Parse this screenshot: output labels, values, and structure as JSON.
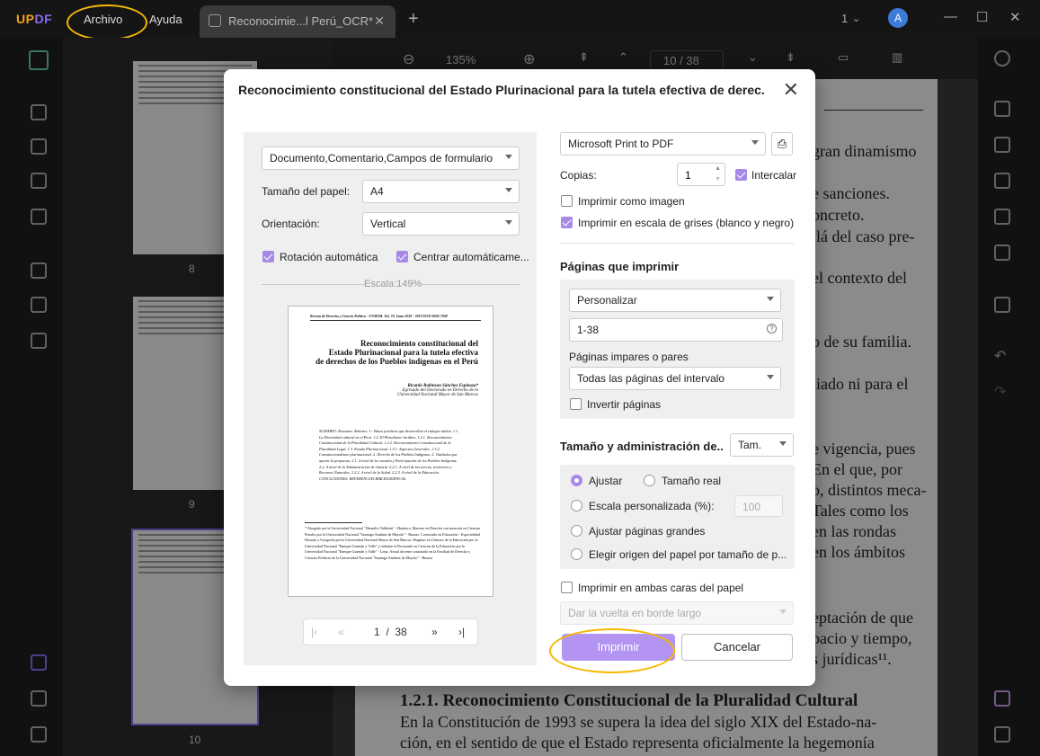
{
  "app": {
    "logo_u": "UP",
    "logo_df": "DF"
  },
  "menu": {
    "file": "Archivo",
    "help": "Ayuda"
  },
  "tab": {
    "title": "Reconocimie...l Perú_OCR*",
    "close": "✕",
    "new": "+"
  },
  "window": {
    "page_indicator": "1",
    "avatar": "A",
    "minimize": "—",
    "maximize": "☐",
    "close": "✕"
  },
  "toolbar": {
    "zoom": "135%",
    "current_page": "10",
    "separator": "/",
    "total_pages": "38"
  },
  "thumbnails": [
    {
      "label": "8"
    },
    {
      "label": "9"
    },
    {
      "label": "10"
    }
  ],
  "document": {
    "lines": [
      "gran dinamismo",
      "e sanciones.",
      "oncreto.",
      "llá del caso pre-",
      "el contexto del",
      "o de su familia.",
      "liado ni para el",
      "e vigencia, pues",
      "En el que, por",
      "o, distintos meca-",
      "Tales como los",
      "en las rondas",
      "en los ámbitos",
      "eptación de que",
      "pacio y tiempo,",
      "s jurídicas¹¹."
    ],
    "heading": "1.2.1. Reconocimiento Constitucional de la Pluralidad Cultural",
    "para1": "En la Constitución de 1993 se supera la idea del siglo XIX del Estado-na-",
    "para2": "ción, en el sentido de que el Estado representa oficialmente la hegemonía"
  },
  "dialog": {
    "title": "Reconocimiento constitucional del Estado Plurinacional para la tutela efectiva de derec.",
    "content_select": "Documento,Comentario,Campos de formulario",
    "paper_size_label": "Tamaño del papel:",
    "paper_size": "A4",
    "orientation_label": "Orientación:",
    "orientation": "Vertical",
    "auto_rotate": "Rotación automática",
    "auto_center": "Centrar automáticame...",
    "scale_label": "Escala:149%",
    "preview": {
      "header": "Revista de Derecho y Ciencia Política - UNMSM. Vol. 74. Lima 2018 - 2019 ISSN 0034-7949",
      "title1": "Reconocimiento constitucional del",
      "title2": "Estado Plurinacional para la tutela efectiva",
      "title3": "de derechos de los Pueblos indígenas en el Perú",
      "author": "Ricardo Robinson Sánchez Espinoza*",
      "aff1": "Egresado del Doctorado en Derecho de la",
      "aff2": "Universidad Nacional Mayor de San Marcos",
      "summary": "SUMARIO: Resumen. Abstract. 1.- Bases jurídicas que desarrollan el enfoque tutelar. 1.1. La Diversidad cultural en el Perú. 1.2. El Pluralismo Jurídico. 1.2.1. Reconocimiento Constitucional de la Pluralidad Cultural. 1.2.2. Reconocimiento Constitucional de la Pluralidad Legal. 1.3. Estado Plurinacional. 1.3.1. Aspectos Generales. 1.3.2. Constitucionalismo plurinacional. 2. Derecho de los Pueblos Indígenas. 2. Tutelados que aporta la propuesta. 2.1. A nivel de la consulta y Participación de los Pueblos Indígenas. 2.2. A nivel de la Administración de Justicia. 2.2.1. A nivel de las tierras, territorios y Recursos Naturales. 2.2.2. A nivel de la Salud. 2.2.3. A nivel de la Educación. CONCLUSIONES. REFERENCIAS BIBLIOGRÁFICAS.",
      "footnote": "* Abogado por la Universidad Nacional \"Hermilio Valdizán\" - Huánuco, Maestro en Derecho con mención en Ciencias Penales por la Universidad Nacional \"Santiago Antúnez de Mayolo\" - Huaraz. Licenciado en Educación - Especialidad Historia y Geografía por la Universidad Nacional Mayor de San Marcos. Magíster en Ciencias de la Educación por la Universidad Nacional \"Enrique Guzmán y Valle\" y culminó el Doctorado en Ciencias de la Educación por la Universidad Nacional \"Enrique Guzmán y Valle\" - Lima. Actual docente contratado en la Facultad de Derecho y Ciencias Políticas de la Universidad Nacional \"Santiago Antúnez de Mayolo\" - Huaraz"
    },
    "pager": {
      "current": "1",
      "sep": "/",
      "total": "38"
    },
    "printer": "Microsoft Print to PDF",
    "copies_label": "Copias:",
    "copies": "1",
    "collate": "Intercalar",
    "print_as_image": "Imprimir como imagen",
    "grayscale": "Imprimir en escala de grises (blanco y negro)",
    "pages_heading": "Páginas que imprimir",
    "pages_mode": "Personalizar",
    "page_range": "1-38",
    "odd_even_label": "Páginas impares o pares",
    "odd_even": "Todas las páginas del intervalo",
    "reverse": "Invertir páginas",
    "size_heading": "Tamaño y administración de..",
    "size_select": "Tam.",
    "fit": "Ajustar",
    "actual_size": "Tamaño real",
    "custom_scale": "Escala personalizada (%):",
    "custom_scale_value": "100",
    "shrink_large": "Ajustar páginas grandes",
    "paper_source": "Elegir origen del papel por tamaño de p...",
    "duplex": "Imprimir en ambas caras del papel",
    "flip": "Dar la vuelta en borde largo",
    "print_button": "Imprimir",
    "cancel_button": "Cancelar"
  },
  "colors": {
    "accent": "#b394f2",
    "highlight": "#f5b800",
    "titlebar": "#151515"
  }
}
